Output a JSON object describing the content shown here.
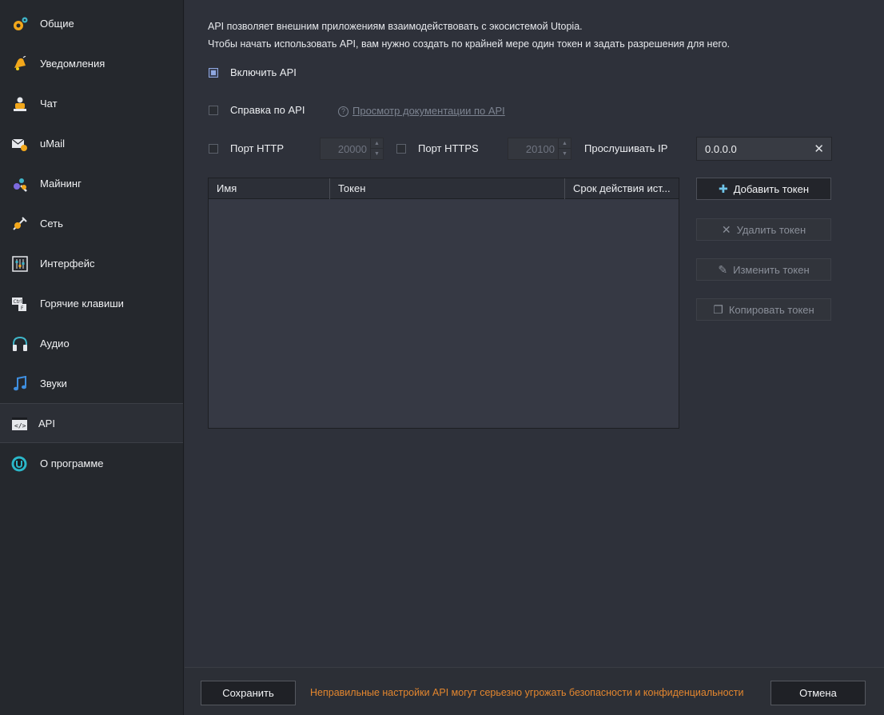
{
  "sidebar": {
    "items": [
      {
        "label": "Общие",
        "icon": "gear-icon"
      },
      {
        "label": "Уведомления",
        "icon": "bell-icon"
      },
      {
        "label": "Чат",
        "icon": "chat-icon"
      },
      {
        "label": "uMail",
        "icon": "mail-icon"
      },
      {
        "label": "Майнинг",
        "icon": "mining-icon"
      },
      {
        "label": "Сеть",
        "icon": "network-icon"
      },
      {
        "label": "Интерфейс",
        "icon": "sliders-icon"
      },
      {
        "label": "Горячие клавиши",
        "icon": "keyboard-icon"
      },
      {
        "label": "Аудио",
        "icon": "headphones-icon"
      },
      {
        "label": "Звуки",
        "icon": "music-note-icon"
      },
      {
        "label": "API",
        "icon": "code-icon"
      },
      {
        "label": "О программе",
        "icon": "utopia-logo-icon"
      }
    ],
    "active": "API"
  },
  "intro": {
    "line1": "API позволяет внешним приложениям взаимодействовать с экосистемой Utopia.",
    "line2": "Чтобы начать использовать API, вам нужно создать по крайней мере один токен и задать разрешения для него."
  },
  "enable_api": {
    "label": "Включить API",
    "checked": true
  },
  "api_help": {
    "label": "Справка по API",
    "checked": false,
    "doc_link": "Просмотр документации по API"
  },
  "ports": {
    "http_label": "Порт HTTP",
    "http_checked": false,
    "http_value": "20000",
    "https_label": "Порт HTTPS",
    "https_checked": false,
    "https_value": "20100",
    "listen_label": "Прослушивать IP",
    "listen_value": "0.0.0.0"
  },
  "tokens_table": {
    "columns": [
      "Имя",
      "Токен",
      "Срок действия ист..."
    ],
    "rows": []
  },
  "actions": {
    "add": "Добавить токен",
    "delete": "Удалить токен",
    "edit": "Изменить токен",
    "copy": "Копировать токен"
  },
  "footer": {
    "save": "Сохранить",
    "warning": "Неправильные настройки API могут серьезно угрожать безопасности и конфиденциальности",
    "cancel": "Отмена"
  },
  "colors": {
    "accent": "#8fa7e0",
    "warning": "#e3862e",
    "background": "#2e313a",
    "sidebar": "#25282d"
  }
}
